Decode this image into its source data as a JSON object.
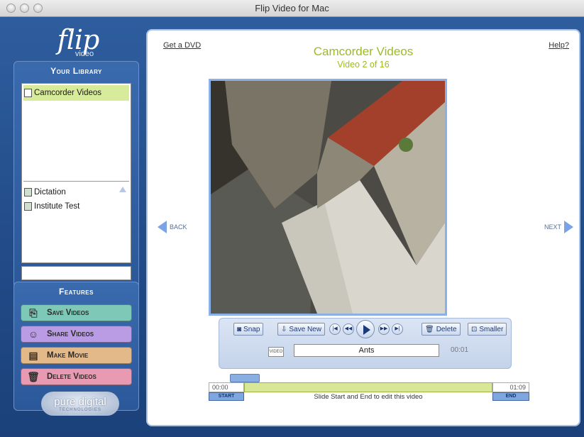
{
  "window": {
    "title": "Flip Video for Mac"
  },
  "brand": {
    "logo_word": "flip",
    "logo_sub": "video"
  },
  "library": {
    "heading": "Your Library",
    "items": [
      {
        "label": "Camcorder Videos",
        "icon": "camcorder-icon",
        "selected": true
      },
      {
        "label": "Dictation",
        "icon": "album-icon"
      },
      {
        "label": "Institute Test",
        "icon": "album-icon"
      }
    ]
  },
  "features": {
    "heading": "Features",
    "buttons": [
      {
        "label": "Save Videos",
        "icon": "save-icon",
        "color": "#7dc8b6"
      },
      {
        "label": "Share Videos",
        "icon": "share-icon",
        "color": "#b99ce3"
      },
      {
        "label": "Make Movie",
        "icon": "movie-icon",
        "color": "#e3b98a"
      },
      {
        "label": "Delete Videos",
        "icon": "trash-icon",
        "color": "#e89ab3"
      }
    ]
  },
  "company": {
    "name": "pure digital",
    "tagline": "TECHNOLOGIES"
  },
  "main": {
    "get_dvd": "Get a DVD",
    "help": "Help?",
    "title": "Camcorder Videos",
    "subtitle": "Video 2 of 16",
    "back": "BACK",
    "next": "NEXT"
  },
  "controls": {
    "snap": "Snap",
    "save_new": "Save New",
    "delete": "Delete",
    "smaller": "Smaller",
    "video_tag": "VIDEO",
    "video_title": "Ants",
    "current_time": "00:01"
  },
  "timeline": {
    "start_time": "00:00",
    "end_time": "01:09",
    "start_label": "START",
    "end_label": "END",
    "hint": "Slide Start and End to edit this video"
  }
}
